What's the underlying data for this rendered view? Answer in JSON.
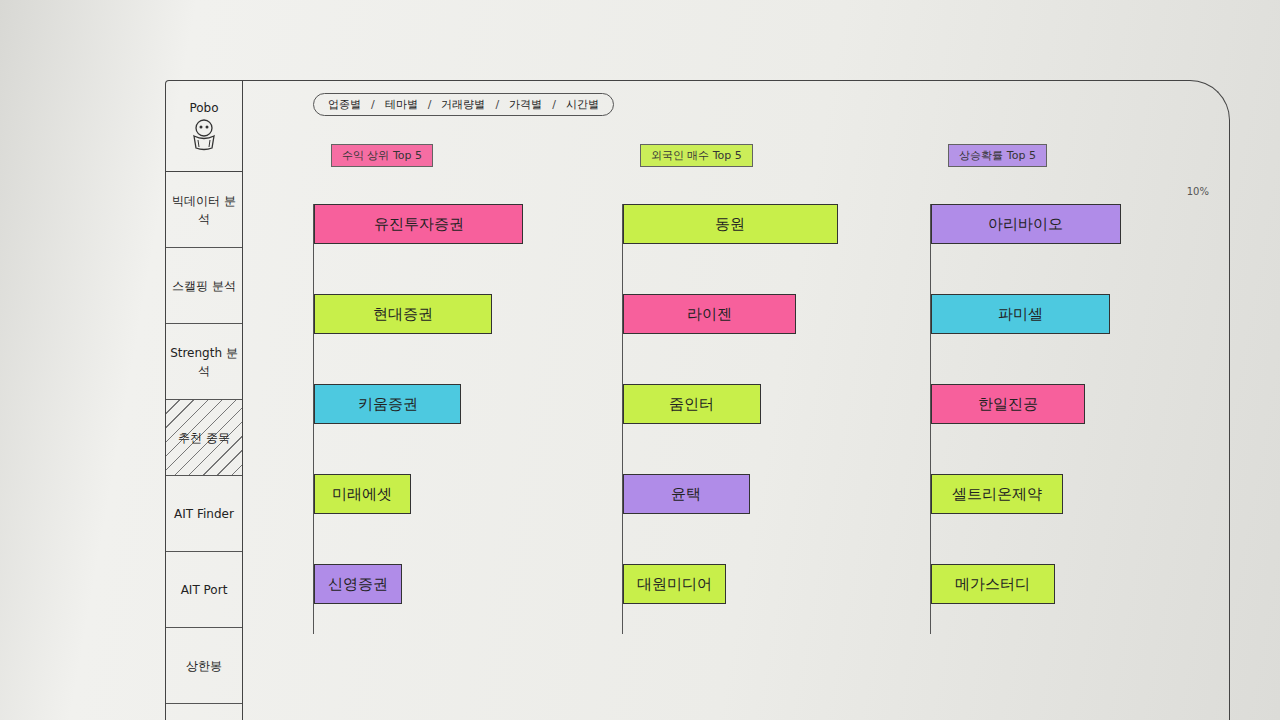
{
  "logo": {
    "text": "Pobo"
  },
  "sidebar": {
    "items": [
      {
        "label": "빅데이터 분석",
        "selected": false
      },
      {
        "label": "스캘핑 분석",
        "selected": false
      },
      {
        "label": "Strength 분석",
        "selected": false
      },
      {
        "label": "추천 종목",
        "selected": true
      },
      {
        "label": "AIT Finder",
        "selected": false
      },
      {
        "label": "AIT Port",
        "selected": false
      },
      {
        "label": "상한봉",
        "selected": false
      }
    ]
  },
  "tabs": {
    "separator": "/",
    "items": [
      {
        "label": "업종별",
        "selected": false
      },
      {
        "label": "테마별",
        "selected": false
      },
      {
        "label": "거래량별",
        "selected": false
      },
      {
        "label": "가격별",
        "selected": false
      },
      {
        "label": "시간별",
        "selected": false
      }
    ]
  },
  "scale_label": "10%",
  "columns": [
    {
      "title": "수익 상위 Top 5",
      "color": "#f7609c",
      "items": [
        {
          "name": "유진투자증권",
          "level": 0.95,
          "color": "#f7609c"
        },
        {
          "name": "현대증권",
          "level": 0.81,
          "color": "#c8ef4a"
        },
        {
          "name": "키움증권",
          "level": 0.67,
          "color": "#4dc9e0"
        },
        {
          "name": "미래에셋",
          "level": 0.44,
          "color": "#c8ef4a"
        },
        {
          "name": "신영증권",
          "level": 0.4,
          "color": "#b08ce8"
        }
      ]
    },
    {
      "title": "외국인 매수 Top 5",
      "color": "#c8ef4a",
      "items": [
        {
          "name": "동원",
          "level": 0.98,
          "color": "#c8ef4a"
        },
        {
          "name": "라이젠",
          "level": 0.79,
          "color": "#f7609c"
        },
        {
          "name": "줌인터",
          "level": 0.63,
          "color": "#c8ef4a"
        },
        {
          "name": "윤택",
          "level": 0.58,
          "color": "#b08ce8"
        },
        {
          "name": "대원미디어",
          "level": 0.47,
          "color": "#c8ef4a"
        }
      ]
    },
    {
      "title": "상승확률 Top 5",
      "color": "#b08ce8",
      "items": [
        {
          "name": "아리바이오",
          "level": 0.86,
          "color": "#b08ce8"
        },
        {
          "name": "파미셀",
          "level": 0.81,
          "color": "#4dc9e0"
        },
        {
          "name": "한일진공",
          "level": 0.7,
          "color": "#f7609c"
        },
        {
          "name": "셀트리온제약",
          "level": 0.6,
          "color": "#c8ef4a"
        },
        {
          "name": "메가스터디",
          "level": 0.56,
          "color": "#c8ef4a"
        }
      ]
    }
  ]
}
